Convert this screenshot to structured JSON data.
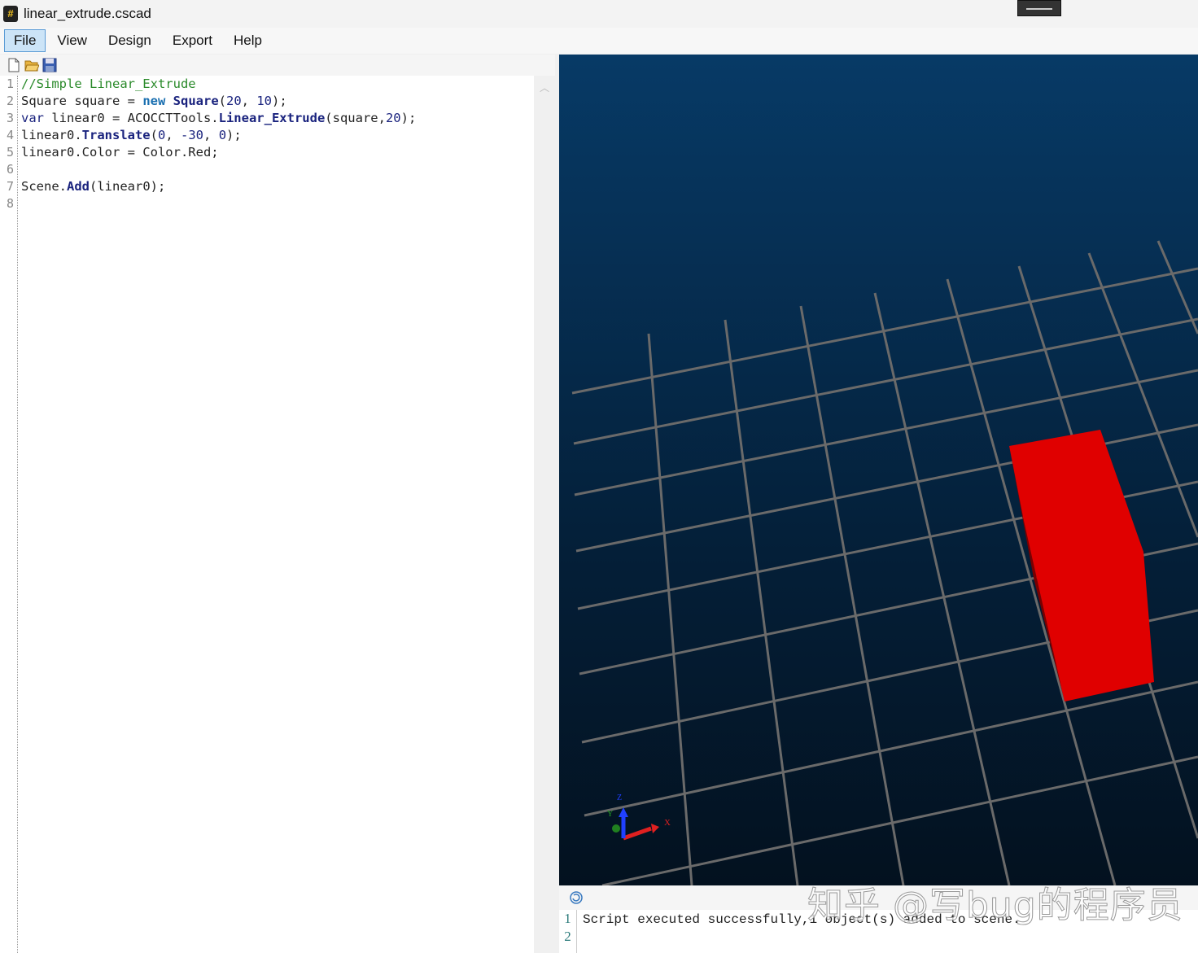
{
  "window": {
    "title": "linear_extrude.cscad",
    "app_icon": "#"
  },
  "menu": [
    "File",
    "View",
    "Design",
    "Export",
    "Help"
  ],
  "toolbar": {
    "icons": [
      "new-file-icon",
      "open-folder-icon",
      "save-icon"
    ]
  },
  "editor": {
    "line_numbers": [
      "1",
      "2",
      "3",
      "4",
      "5",
      "6",
      "7",
      "8"
    ],
    "lines": [
      [
        {
          "t": "//Simple Linear_Extrude",
          "c": "cm"
        }
      ],
      [
        {
          "t": "Square square = ",
          "c": ""
        },
        {
          "t": "new",
          "c": "kw"
        },
        {
          "t": " ",
          "c": ""
        },
        {
          "t": "Square",
          "c": "fn"
        },
        {
          "t": "(",
          "c": ""
        },
        {
          "t": "20",
          "c": "nm"
        },
        {
          "t": ", ",
          "c": ""
        },
        {
          "t": "10",
          "c": "nm"
        },
        {
          "t": ");",
          "c": ""
        }
      ],
      [
        {
          "t": "var",
          "c": "nm"
        },
        {
          "t": " linear0 = ACOCCTTools.",
          "c": ""
        },
        {
          "t": "Linear_Extrude",
          "c": "fn"
        },
        {
          "t": "(square,",
          "c": ""
        },
        {
          "t": "20",
          "c": "nm"
        },
        {
          "t": ");",
          "c": ""
        }
      ],
      [
        {
          "t": "linear0.",
          "c": ""
        },
        {
          "t": "Translate",
          "c": "fn"
        },
        {
          "t": "(",
          "c": ""
        },
        {
          "t": "0",
          "c": "nm"
        },
        {
          "t": ", ",
          "c": ""
        },
        {
          "t": "-30",
          "c": "nm"
        },
        {
          "t": ", ",
          "c": ""
        },
        {
          "t": "0",
          "c": "nm"
        },
        {
          "t": ");",
          "c": ""
        }
      ],
      [
        {
          "t": "linear0.Color = Color.Red;",
          "c": ""
        }
      ],
      [],
      [
        {
          "t": "Scene.",
          "c": ""
        },
        {
          "t": "Add",
          "c": "fn"
        },
        {
          "t": "(linear0);",
          "c": ""
        }
      ],
      []
    ]
  },
  "viewport": {
    "object_color": "#e00000",
    "axes": {
      "x": "X",
      "y": "Y",
      "z": "Z"
    }
  },
  "console": {
    "line_numbers": [
      "1",
      "2"
    ],
    "lines": [
      "Script executed successfully,1 object(s) added to scene."
    ]
  },
  "watermark": "知乎 @写bug的程序员"
}
